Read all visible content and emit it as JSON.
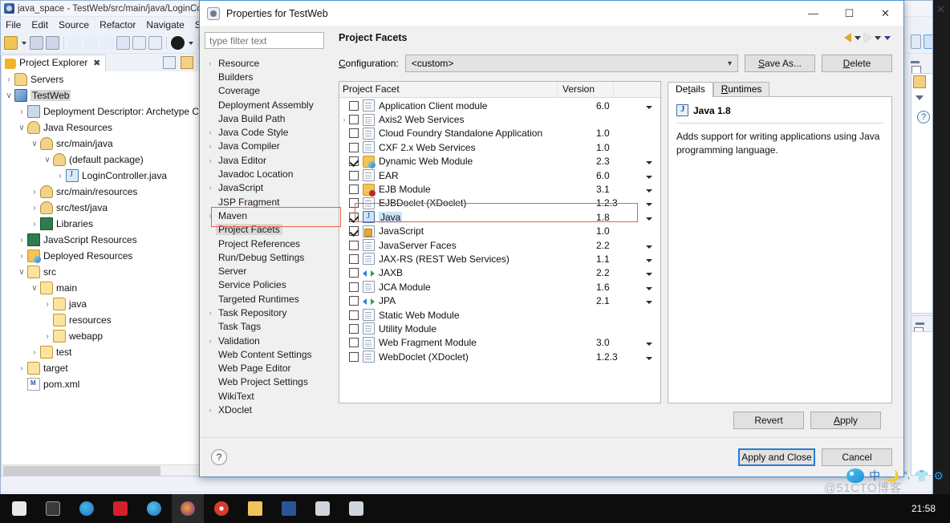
{
  "eclipse": {
    "title": "java_space - TestWeb/src/main/java/LoginCont",
    "menu": [
      "File",
      "Edit",
      "Source",
      "Refactor",
      "Navigate",
      "Search"
    ],
    "view_tab": "Project Explorer",
    "status_text": "TestWeb",
    "tree": [
      {
        "label": "Servers",
        "indent": 0,
        "twisty": "›",
        "icon": "server-folder-icon"
      },
      {
        "label": "TestWeb",
        "indent": 0,
        "twisty": "∨",
        "icon": "web-project-icon",
        "selected": true
      },
      {
        "label": "Deployment Descriptor: Archetype Crea",
        "indent": 1,
        "twisty": "›",
        "icon": "deployment-descriptor-icon"
      },
      {
        "label": "Java Resources",
        "indent": 1,
        "twisty": "∨",
        "icon": "java-resources-icon"
      },
      {
        "label": "src/main/java",
        "indent": 2,
        "twisty": "∨",
        "icon": "source-folder-icon"
      },
      {
        "label": "(default package)",
        "indent": 3,
        "twisty": "∨",
        "icon": "package-icon"
      },
      {
        "label": "LoginController.java",
        "indent": 4,
        "twisty": "›",
        "icon": "java-file-icon"
      },
      {
        "label": "src/main/resources",
        "indent": 2,
        "twisty": "›",
        "icon": "source-folder-icon"
      },
      {
        "label": "src/test/java",
        "indent": 2,
        "twisty": "›",
        "icon": "source-folder-icon"
      },
      {
        "label": "Libraries",
        "indent": 2,
        "twisty": "›",
        "icon": "libraries-icon"
      },
      {
        "label": "JavaScript Resources",
        "indent": 1,
        "twisty": "›",
        "icon": "javascript-resources-icon"
      },
      {
        "label": "Deployed Resources",
        "indent": 1,
        "twisty": "›",
        "icon": "deployed-resources-icon"
      },
      {
        "label": "src",
        "indent": 1,
        "twisty": "∨",
        "icon": "folder-icon"
      },
      {
        "label": "main",
        "indent": 2,
        "twisty": "∨",
        "icon": "folder-icon"
      },
      {
        "label": "java",
        "indent": 3,
        "twisty": "›",
        "icon": "folder-icon"
      },
      {
        "label": "resources",
        "indent": 3,
        "twisty": "",
        "icon": "folder-icon"
      },
      {
        "label": "webapp",
        "indent": 3,
        "twisty": "›",
        "icon": "folder-icon"
      },
      {
        "label": "test",
        "indent": 2,
        "twisty": "›",
        "icon": "folder-icon"
      },
      {
        "label": "target",
        "indent": 1,
        "twisty": "›",
        "icon": "folder-icon"
      },
      {
        "label": "pom.xml",
        "indent": 1,
        "twisty": "",
        "icon": "xml-file-icon"
      }
    ]
  },
  "dialog": {
    "title": "Properties for TestWeb",
    "window_buttons": {
      "minimize": "—",
      "maximize": "☐",
      "close": "✕"
    },
    "filter_placeholder": "type filter text",
    "page_title": "Project Facets",
    "nav": {
      "back": "back-arrow",
      "forward": "forward-arrow",
      "menu": "view-menu"
    },
    "tree_items": [
      {
        "label": "Resource",
        "expandable": true
      },
      {
        "label": "Builders",
        "expandable": false
      },
      {
        "label": "Coverage",
        "expandable": false
      },
      {
        "label": "Deployment Assembly",
        "expandable": false
      },
      {
        "label": "Java Build Path",
        "expandable": false
      },
      {
        "label": "Java Code Style",
        "expandable": true
      },
      {
        "label": "Java Compiler",
        "expandable": true
      },
      {
        "label": "Java Editor",
        "expandable": true
      },
      {
        "label": "Javadoc Location",
        "expandable": false
      },
      {
        "label": "JavaScript",
        "expandable": true
      },
      {
        "label": "JSP Fragment",
        "expandable": false
      },
      {
        "label": "Maven",
        "expandable": true
      },
      {
        "label": "Project Facets",
        "expandable": false,
        "selected": true
      },
      {
        "label": "Project References",
        "expandable": false
      },
      {
        "label": "Run/Debug Settings",
        "expandable": false
      },
      {
        "label": "Server",
        "expandable": false
      },
      {
        "label": "Service Policies",
        "expandable": false
      },
      {
        "label": "Targeted Runtimes",
        "expandable": false
      },
      {
        "label": "Task Repository",
        "expandable": true
      },
      {
        "label": "Task Tags",
        "expandable": false
      },
      {
        "label": "Validation",
        "expandable": true
      },
      {
        "label": "Web Content Settings",
        "expandable": false
      },
      {
        "label": "Web Page Editor",
        "expandable": false
      },
      {
        "label": "Web Project Settings",
        "expandable": false
      },
      {
        "label": "WikiText",
        "expandable": false
      },
      {
        "label": "XDoclet",
        "expandable": true
      }
    ],
    "configuration": {
      "label": "Configuration:",
      "value": "<custom>",
      "save_as_button": "Save As...",
      "delete_button": "Delete"
    },
    "facet_table": {
      "columns": [
        "Project Facet",
        "Version"
      ],
      "rows": [
        {
          "name": "Application Client module",
          "version": "6.0",
          "checked": false,
          "expandable": false,
          "has_version_menu": true,
          "icon": "doc-icon"
        },
        {
          "name": "Axis2 Web Services",
          "version": "",
          "checked": false,
          "expandable": true,
          "has_version_menu": false,
          "icon": "doc-icon"
        },
        {
          "name": "Cloud Foundry Standalone Application",
          "version": "1.0",
          "checked": false,
          "expandable": false,
          "has_version_menu": false,
          "icon": "doc-icon"
        },
        {
          "name": "CXF 2.x Web Services",
          "version": "1.0",
          "checked": false,
          "expandable": false,
          "has_version_menu": false,
          "icon": "doc-icon"
        },
        {
          "name": "Dynamic Web Module",
          "version": "2.3",
          "checked": true,
          "expandable": false,
          "has_version_menu": true,
          "icon": "web-module-icon"
        },
        {
          "name": "EAR",
          "version": "6.0",
          "checked": false,
          "expandable": false,
          "has_version_menu": true,
          "icon": "doc-icon"
        },
        {
          "name": "EJB Module",
          "version": "3.1",
          "checked": false,
          "expandable": false,
          "has_version_menu": true,
          "icon": "ejb-icon"
        },
        {
          "name": "EJBDoclet (XDoclet)",
          "version": "1.2.3",
          "checked": false,
          "expandable": false,
          "has_version_menu": true,
          "icon": "doc-icon"
        },
        {
          "name": "Java",
          "version": "1.8",
          "checked": true,
          "expandable": false,
          "has_version_menu": true,
          "icon": "java-facet-icon",
          "highlighted": true
        },
        {
          "name": "JavaScript",
          "version": "1.0",
          "checked": true,
          "expandable": false,
          "has_version_menu": false,
          "icon": "javascript-icon"
        },
        {
          "name": "JavaServer Faces",
          "version": "2.2",
          "checked": false,
          "expandable": false,
          "has_version_menu": true,
          "icon": "doc-icon"
        },
        {
          "name": "JAX-RS (REST Web Services)",
          "version": "1.1",
          "checked": false,
          "expandable": false,
          "has_version_menu": true,
          "icon": "doc-icon"
        },
        {
          "name": "JAXB",
          "version": "2.2",
          "checked": false,
          "expandable": false,
          "has_version_menu": true,
          "icon": "jaxb-icon"
        },
        {
          "name": "JCA Module",
          "version": "1.6",
          "checked": false,
          "expandable": false,
          "has_version_menu": true,
          "icon": "doc-icon"
        },
        {
          "name": "JPA",
          "version": "2.1",
          "checked": false,
          "expandable": false,
          "has_version_menu": true,
          "icon": "jaxb-icon"
        },
        {
          "name": "Static Web Module",
          "version": "",
          "checked": false,
          "expandable": false,
          "has_version_menu": false,
          "icon": "doc-icon"
        },
        {
          "name": "Utility Module",
          "version": "",
          "checked": false,
          "expandable": false,
          "has_version_menu": false,
          "icon": "doc-icon"
        },
        {
          "name": "Web Fragment Module",
          "version": "3.0",
          "checked": false,
          "expandable": false,
          "has_version_menu": true,
          "icon": "doc-icon"
        },
        {
          "name": "WebDoclet (XDoclet)",
          "version": "1.2.3",
          "checked": false,
          "expandable": false,
          "has_version_menu": true,
          "icon": "doc-icon"
        }
      ]
    },
    "details": {
      "tabs": [
        {
          "label": "Details",
          "active": true
        },
        {
          "label": "Runtimes",
          "active": false
        }
      ],
      "facet_title": "Java 1.8",
      "description": "Adds support for writing applications using Java programming language."
    },
    "buttons": {
      "revert": "Revert",
      "apply": "Apply",
      "apply_and_close": "Apply and Close",
      "cancel": "Cancel",
      "help": "?"
    }
  },
  "taskbar": {
    "clock": "21:58",
    "watermark": "@51CTO博客",
    "tray_text": "中"
  },
  "colors": {
    "accent": "#2a7ad4",
    "annotation": "#e8604c",
    "dialog_bg": "#f0f0f0",
    "eclipse_bg": "#eef1f8"
  }
}
